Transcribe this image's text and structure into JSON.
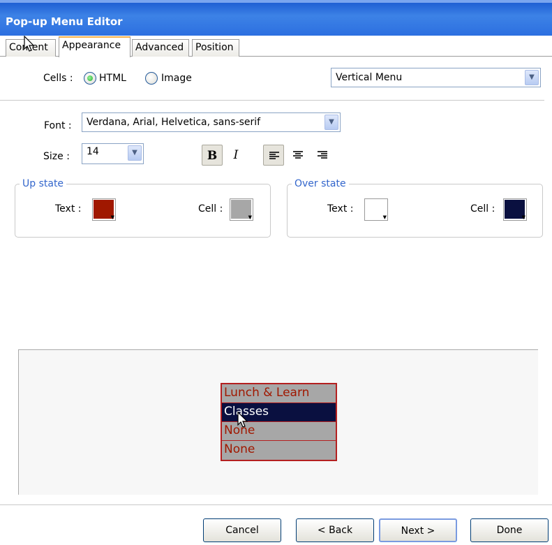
{
  "window": {
    "title": "Pop-up Menu Editor"
  },
  "tabs": [
    {
      "label": "Content"
    },
    {
      "label": "Appearance"
    },
    {
      "label": "Advanced"
    },
    {
      "label": "Position"
    }
  ],
  "cells": {
    "label": "Cells :",
    "html_option": "HTML",
    "image_option": "Image",
    "selected": "HTML",
    "menu_type": "Vertical Menu"
  },
  "font": {
    "label": "Font :",
    "value": "Verdana, Arial, Helvetica, sans-serif",
    "size_label": "Size :",
    "size_value": "14",
    "bold": "B",
    "italic": "I"
  },
  "up_state": {
    "legend": "Up state",
    "text_label": "Text :",
    "cell_label": "Cell :",
    "text_color": "#a01800",
    "cell_color": "#a7a7a7"
  },
  "over_state": {
    "legend": "Over state",
    "text_label": "Text :",
    "cell_label": "Cell :",
    "text_color": "#ffffff",
    "cell_color": "#0a1040"
  },
  "preview": {
    "items": [
      "Lunch & Learn",
      "Classes",
      "None",
      "None"
    ],
    "hovered_index": 1
  },
  "buttons": {
    "cancel": "Cancel",
    "back": "< Back",
    "next": "Next >",
    "done": "Done"
  }
}
